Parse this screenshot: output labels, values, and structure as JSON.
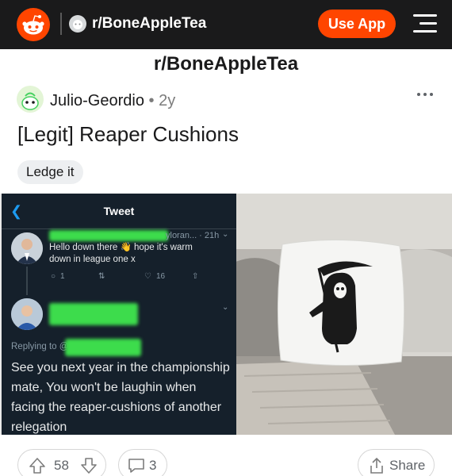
{
  "header": {
    "subreddit": "r/BoneAppleTea",
    "use_app_label": "Use App",
    "icons": [
      "reddit-logo-icon",
      "subreddit-icon",
      "menu-icon"
    ]
  },
  "page_heading": "r/BoneAppleTea",
  "post": {
    "author": "Julio-Geordio",
    "separator": "•",
    "age": "2y",
    "title": "[Legit] Reaper Cushions",
    "flair": "Ledge it",
    "upvotes": "58",
    "comments": "3",
    "share_label": "Share"
  },
  "tweet": {
    "header_title": "Tweet",
    "first_reply": {
      "meta": "yloran... · 21h",
      "text": "Hello down there 👋 hope it's warm down in league one x",
      "likes": "16",
      "replies": "1"
    },
    "replying_to": "Replying to @",
    "second_reply_text": "See you next year in the championship mate, You won't be laughin when facing the reaper-cushions of another relegation"
  },
  "colors": {
    "topbar": "#1a1a1b",
    "accent": "#ff4500",
    "tweet_bg": "#15202b",
    "redaction": "#3ddc4c"
  }
}
